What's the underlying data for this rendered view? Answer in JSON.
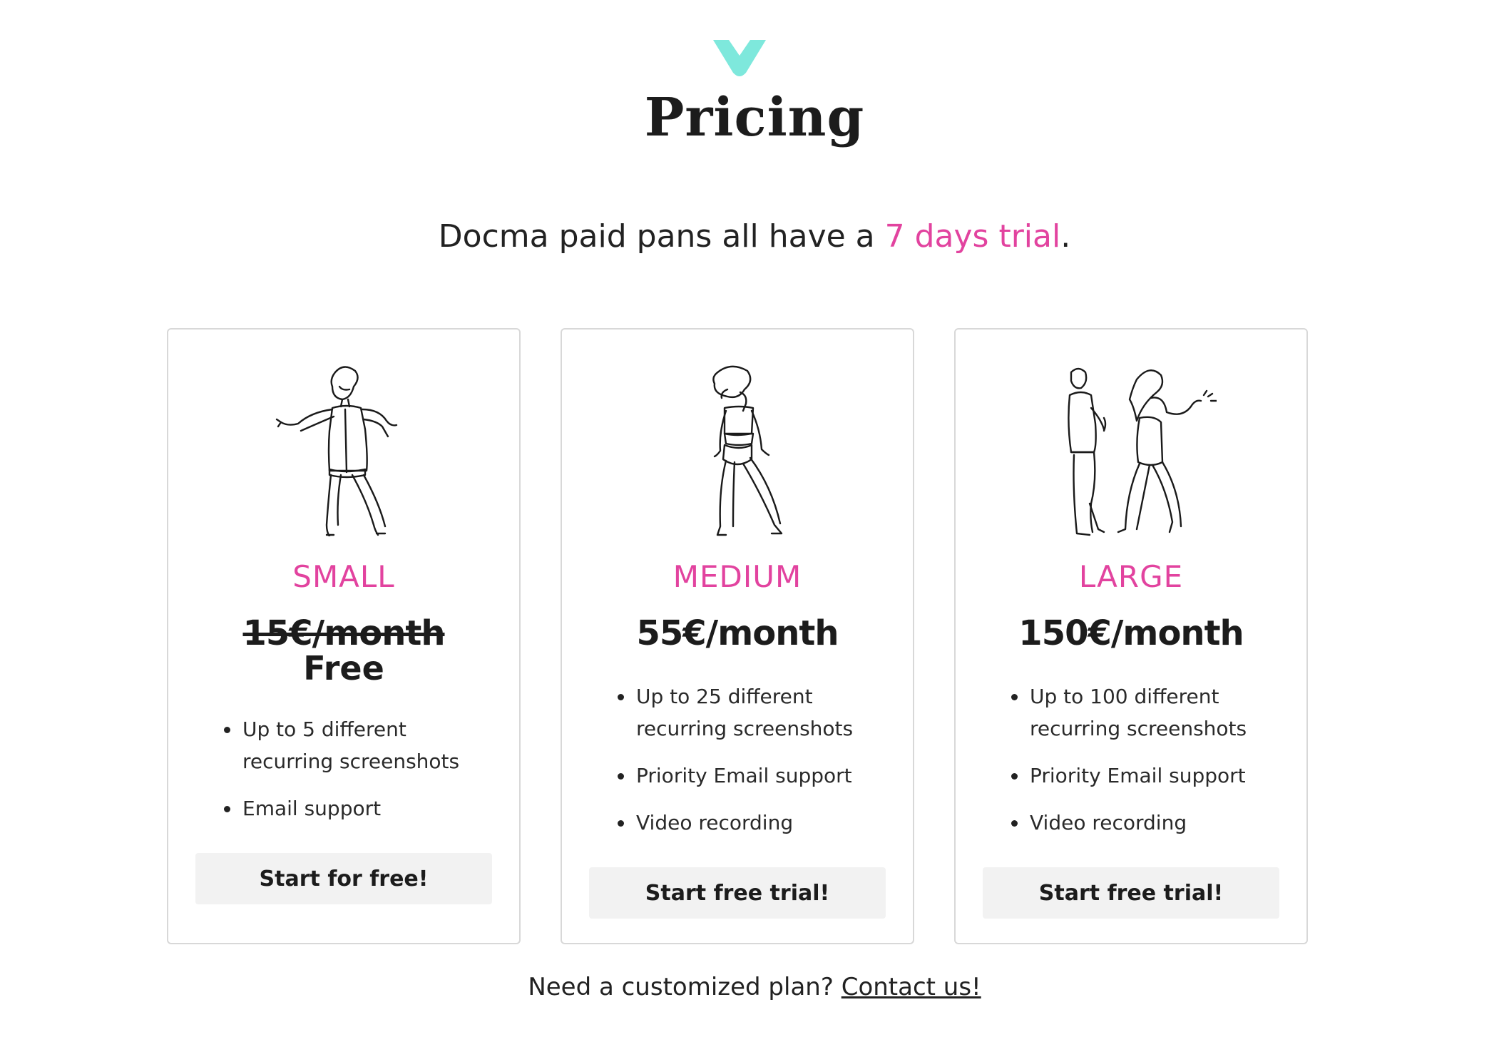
{
  "colors": {
    "accent": "#e2439f",
    "logo": "#7ee8dc",
    "button_bg": "#f2f2f2"
  },
  "header": {
    "logo_icon": "chevron-v-logo",
    "title": "Pricing",
    "subtitle_prefix": "Docma paid pans all have a ",
    "subtitle_highlight": "7 days trial",
    "subtitle_suffix": "."
  },
  "plans": [
    {
      "illustration": "dancing-man-illustration",
      "name": "SMALL",
      "price": "15€/month",
      "price_struck": true,
      "price_alt": "Free",
      "features": [
        "Up to 5 different recurring screenshots",
        "Email support"
      ],
      "cta": "Start for free!"
    },
    {
      "illustration": "dancing-woman-illustration",
      "name": "MEDIUM",
      "price": "55€/month",
      "price_struck": false,
      "features": [
        "Up to 25 different recurring screenshots",
        "Priority Email support",
        "Video recording"
      ],
      "cta": "Start free trial!"
    },
    {
      "illustration": "dancing-couple-illustration",
      "name": "LARGE",
      "price": "150€/month",
      "price_struck": false,
      "features": [
        "Up to 100 different recurring screenshots",
        "Priority Email support",
        "Video recording"
      ],
      "cta": "Start free trial!"
    }
  ],
  "footer": {
    "text": "Need a customized plan? ",
    "link": "Contact us!"
  }
}
